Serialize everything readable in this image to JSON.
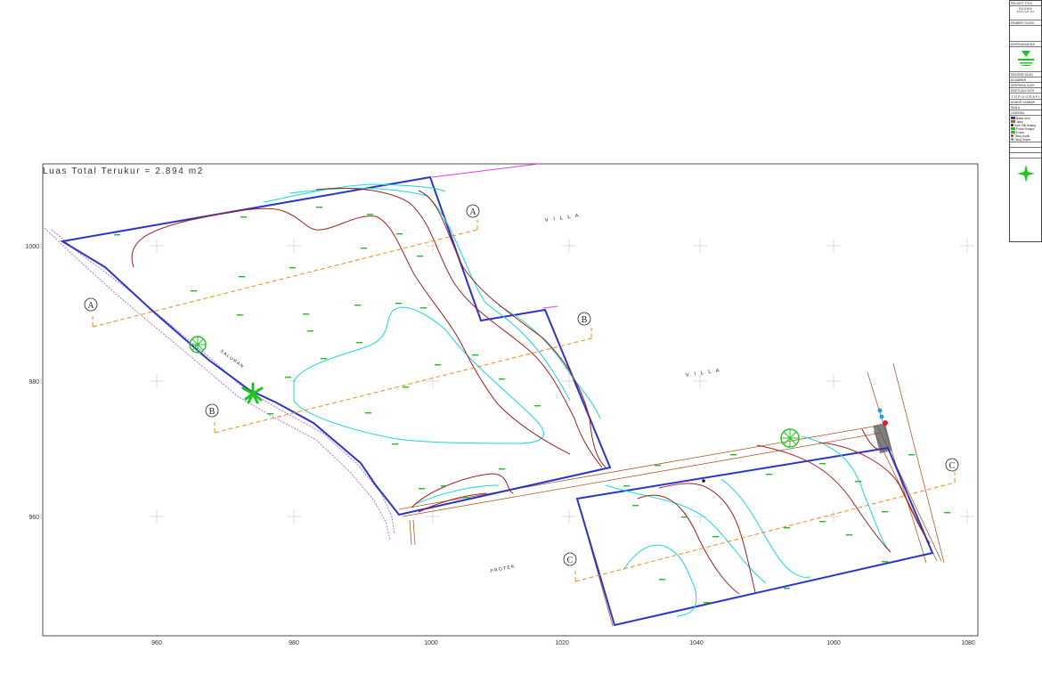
{
  "area_label": "Luas Total Terukur = 2.894 m2",
  "axis": {
    "x_ticks": [
      "960",
      "980",
      "1000",
      "1020",
      "1040",
      "1060",
      "1080"
    ],
    "y_ticks": [
      "1000",
      "980",
      "960"
    ]
  },
  "section_markers": [
    "A",
    "A",
    "B",
    "B",
    "C",
    "C"
  ],
  "place_labels": {
    "villa_top": "V I L L A",
    "villa_right": "V I L L A",
    "protek": "P R O T E K",
    "saluran": "S A L U R A N"
  },
  "colors": {
    "boundary": "#2a35c9",
    "contour_major": "#a0201c",
    "contour_minor": "#19d6e0",
    "section_line": "#f08a1e",
    "road": "#b25a2a",
    "channel": "#8a3cf0",
    "spot_height": "#2ab82a",
    "tree": "#1fc41f",
    "magenta": "#e43be4"
  },
  "title_block": {
    "project_title": "PROJECT TITLE",
    "project_name": "B E A M A",
    "project_sub": "B A D U N G - B A",
    "pemberi_tugas": "PEMBERI TUGAS",
    "dikerjakan": "DIKERJAKAN OLE",
    "rows": [
      "DISURVEI OLEH",
      "DIGAMBAR",
      "DIPERIKSA OLEH",
      "DISETUJUI OLEH"
    ],
    "drawing_title": "T O P O G R A F I",
    "scale_rows": [
      "NOMOR GAMBAR",
      "SKALA"
    ],
    "legend_title": "LEGENDA",
    "legend": [
      {
        "label": "Batas Ukur",
        "color": "#2a35c9"
      },
      {
        "label": "Jalan",
        "color": "#b25a2a"
      },
      {
        "label": "Spot Titik Bidang",
        "color": "#111111"
      },
      {
        "label": "Pohon Kelapa",
        "color": "#1fc41f"
      },
      {
        "label": "Pohon",
        "color": "#1fc41f"
      },
      {
        "label": "Tiang Listrik",
        "color": "#e02020"
      },
      {
        "label": "Tiang Telpon",
        "color": "#19a0e0"
      }
    ]
  }
}
